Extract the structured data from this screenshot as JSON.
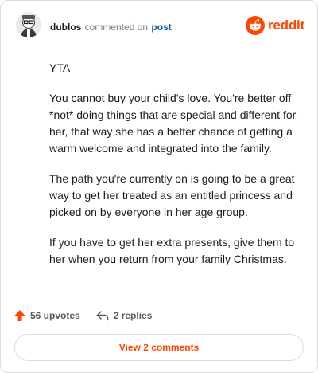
{
  "header": {
    "username": "dublos",
    "commented_text": "commented on",
    "post_link": "post"
  },
  "brand": {
    "logo_text": "reddit",
    "accent_color": "#ff4500",
    "logo_icon": "reddit-snoo-icon"
  },
  "comment": {
    "paragraphs": [
      "YTA",
      "You cannot buy your child's love. You're better off *not* doing things that are special and different for her, that way she has a better chance of getting a warm welcome and integrated into the family.",
      "The path you're currently on is going to be a great way to get her treated as an entitled princess and picked on by everyone in her age group.",
      "If you have to get her extra presents, give them to her when you return from your family Christmas."
    ]
  },
  "actions": {
    "upvotes_label": "56 upvotes",
    "upvote_icon": "upvote-arrow-icon",
    "replies_label": "2 replies",
    "reply_icon": "reply-arrow-icon"
  },
  "footer": {
    "view_comments_label": "View 2 comments"
  }
}
